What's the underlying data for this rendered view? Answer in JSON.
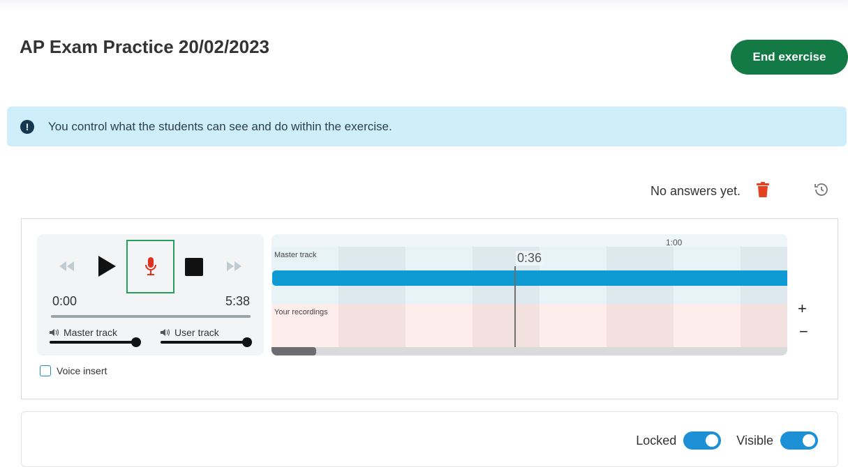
{
  "header": {
    "title": "AP Exam Practice 20/02/2023",
    "end_button_label": "End exercise"
  },
  "banner": {
    "icon": "info-icon",
    "text": "You control what the students can see and do within the exercise."
  },
  "answers": {
    "status_text": "No answers yet.",
    "delete_icon": "trash-icon",
    "history_icon": "history-icon"
  },
  "player": {
    "current_time": "0:00",
    "total_time": "5:38",
    "progress": 0,
    "master_volume_label": "Master track",
    "master_volume_level": 1.0,
    "user_volume_label": "User track",
    "user_volume_level": 1.0,
    "voice_insert_label": "Voice insert",
    "voice_insert_checked": false
  },
  "timeline": {
    "marker_label": "1:00",
    "playhead_label": "0:36",
    "master_lane_label": "Master track",
    "recordings_lane_label": "Your recordings",
    "zoom_in_label": "+",
    "zoom_out_label": "−"
  },
  "settings": {
    "locked_label": "Locked",
    "locked_on": true,
    "visible_label": "Visible",
    "visible_on": true
  },
  "colors": {
    "accent_green": "#137a46",
    "banner_bg": "#cfeefb",
    "master_bar": "#0e9bd4",
    "toggle_on": "#1e90d6",
    "record_red": "#e0301e"
  }
}
